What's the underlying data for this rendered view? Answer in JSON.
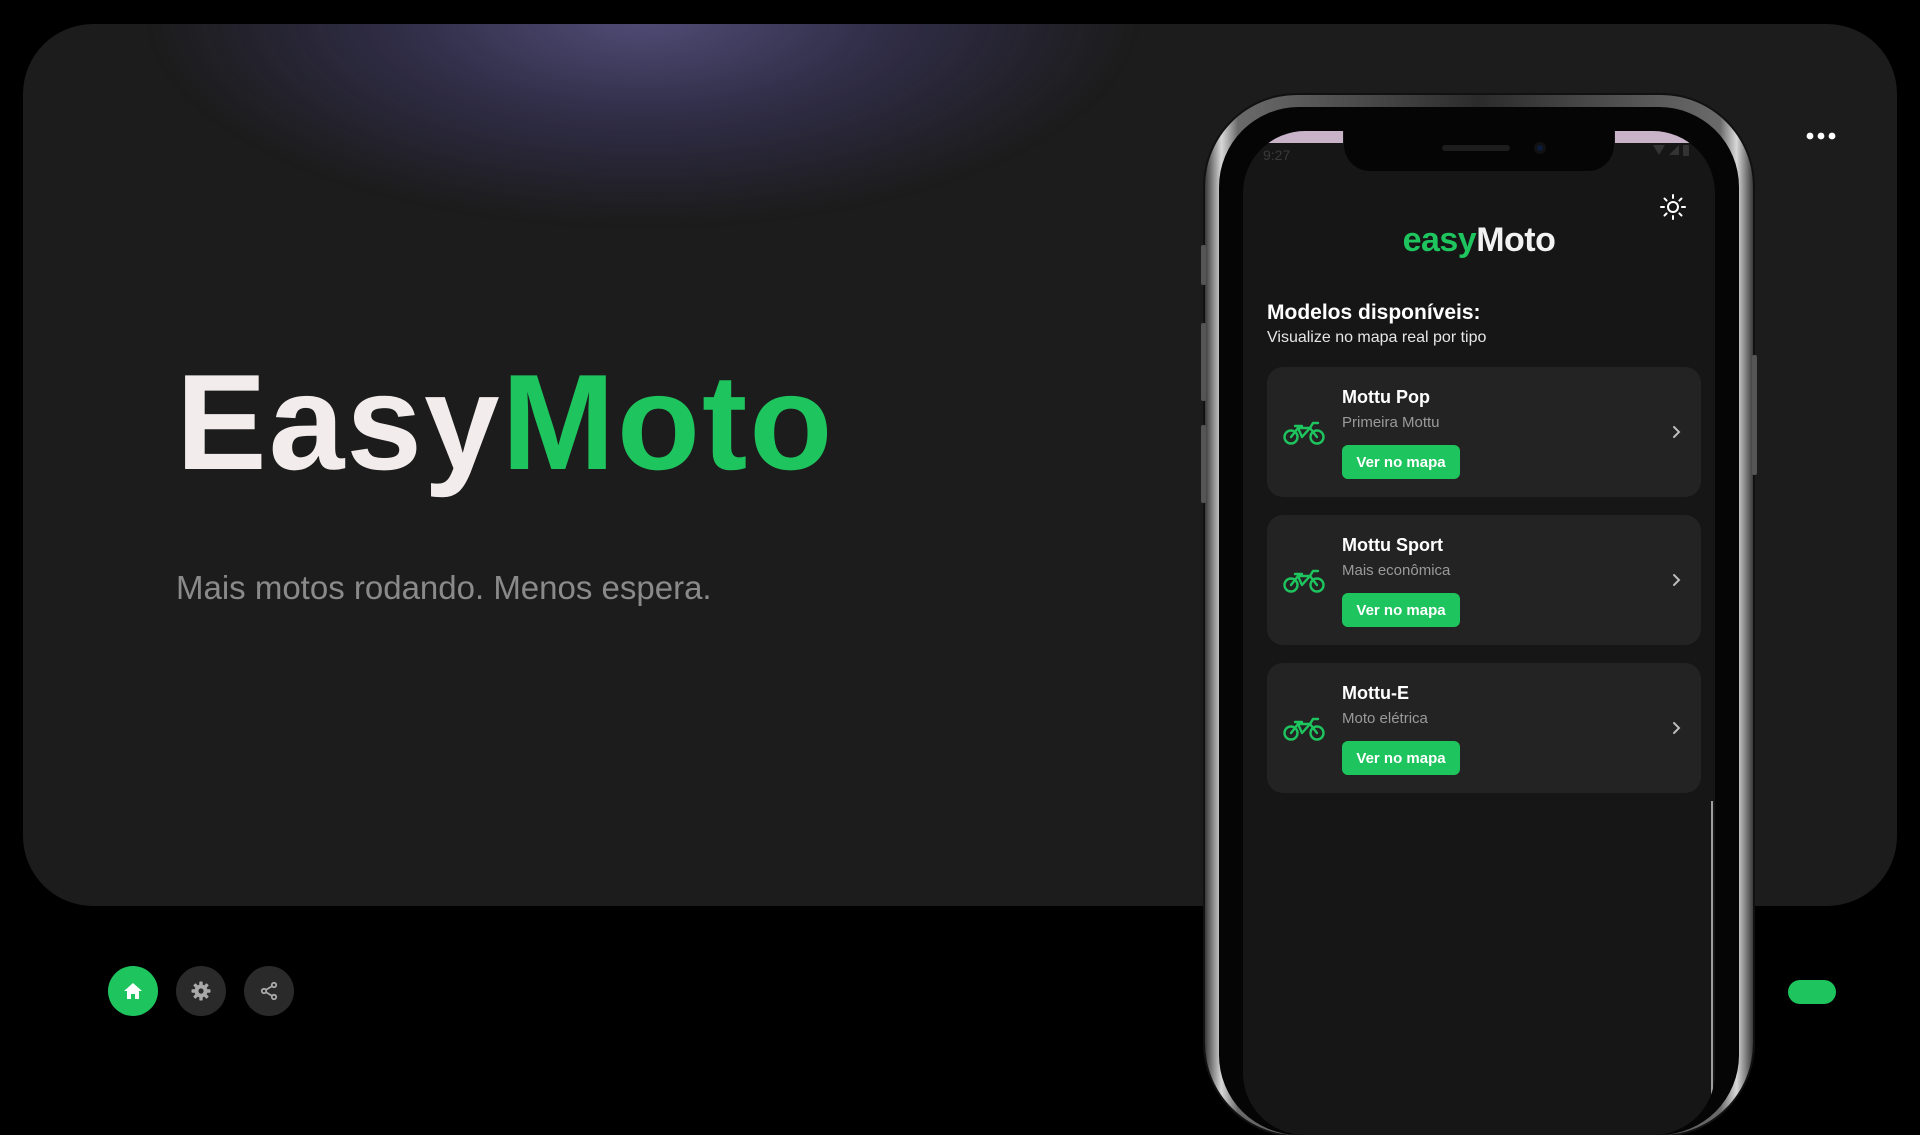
{
  "hero": {
    "title_part1": "Easy",
    "title_part2": "Moto",
    "subtitle": "Mais motos rodando. Menos espera."
  },
  "toolbar": {
    "more_icon": "more-horizontal-icon"
  },
  "bottom_nav": {
    "home_icon": "home-icon",
    "settings_icon": "gear-icon",
    "share_icon": "share-icon"
  },
  "phone": {
    "status_time": "9:27",
    "app": {
      "logo_part1": "easy",
      "logo_part2": "Moto",
      "theme_icon": "sun-icon",
      "section_title": "Modelos disponíveis:",
      "section_subtitle": "Visualize no mapa real por tipo",
      "models": [
        {
          "name": "Mottu Pop",
          "description": "Primeira Mottu",
          "button": "Ver no mapa",
          "icon": "motorcycle-icon"
        },
        {
          "name": "Mottu Sport",
          "description": "Mais econômica",
          "button": "Ver no mapa",
          "icon": "motorcycle-icon"
        },
        {
          "name": "Mottu-E",
          "description": "Moto elétrica",
          "button": "Ver no mapa",
          "icon": "motorcycle-icon"
        }
      ]
    }
  },
  "colors": {
    "accent": "#1ec45e",
    "background": "#000000",
    "panel": "#1c1c1c",
    "card": "#232323"
  }
}
